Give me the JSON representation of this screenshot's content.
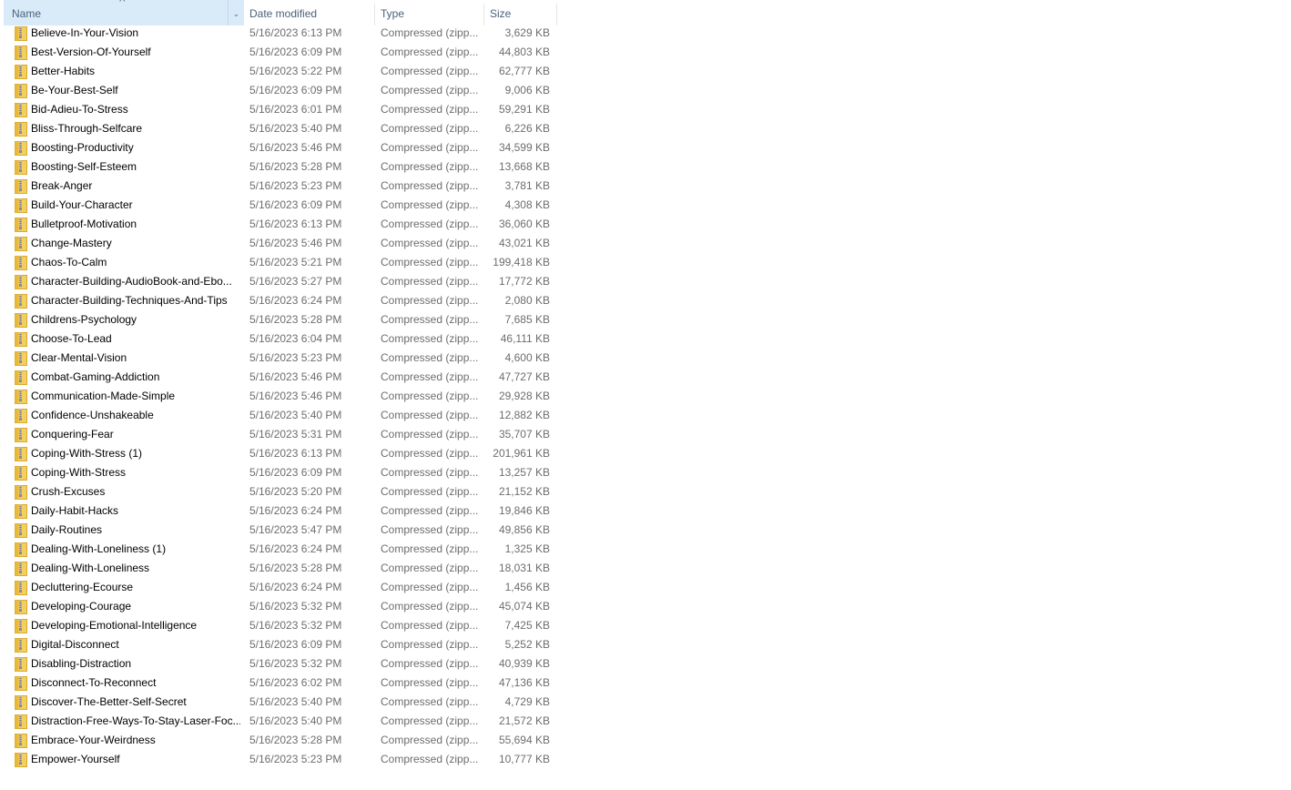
{
  "columns": {
    "name": "Name",
    "date": "Date modified",
    "type": "Type",
    "size": "Size"
  },
  "sort": {
    "column": "name",
    "direction": "ascending"
  },
  "colors": {
    "header_active_bg": "#d9ebf9",
    "header_text": "#4c607a",
    "secondary_text": "#6d6d6d",
    "zip_icon": "#f2c94c"
  },
  "files": [
    {
      "name": "Believe-In-Your-Vision",
      "date": "5/16/2023 6:13 PM",
      "type": "Compressed (zipp...",
      "size": "3,629 KB"
    },
    {
      "name": "Best-Version-Of-Yourself",
      "date": "5/16/2023 6:09 PM",
      "type": "Compressed (zipp...",
      "size": "44,803 KB"
    },
    {
      "name": "Better-Habits",
      "date": "5/16/2023 5:22 PM",
      "type": "Compressed (zipp...",
      "size": "62,777 KB"
    },
    {
      "name": "Be-Your-Best-Self",
      "date": "5/16/2023 6:09 PM",
      "type": "Compressed (zipp...",
      "size": "9,006 KB"
    },
    {
      "name": "Bid-Adieu-To-Stress",
      "date": "5/16/2023 6:01 PM",
      "type": "Compressed (zipp...",
      "size": "59,291 KB"
    },
    {
      "name": "Bliss-Through-Selfcare",
      "date": "5/16/2023 5:40 PM",
      "type": "Compressed (zipp...",
      "size": "6,226 KB"
    },
    {
      "name": "Boosting-Productivity",
      "date": "5/16/2023 5:46 PM",
      "type": "Compressed (zipp...",
      "size": "34,599 KB"
    },
    {
      "name": "Boosting-Self-Esteem",
      "date": "5/16/2023 5:28 PM",
      "type": "Compressed (zipp...",
      "size": "13,668 KB"
    },
    {
      "name": "Break-Anger",
      "date": "5/16/2023 5:23 PM",
      "type": "Compressed (zipp...",
      "size": "3,781 KB"
    },
    {
      "name": "Build-Your-Character",
      "date": "5/16/2023 6:09 PM",
      "type": "Compressed (zipp...",
      "size": "4,308 KB"
    },
    {
      "name": "Bulletproof-Motivation",
      "date": "5/16/2023 6:13 PM",
      "type": "Compressed (zipp...",
      "size": "36,060 KB"
    },
    {
      "name": "Change-Mastery",
      "date": "5/16/2023 5:46 PM",
      "type": "Compressed (zipp...",
      "size": "43,021 KB"
    },
    {
      "name": "Chaos-To-Calm",
      "date": "5/16/2023 5:21 PM",
      "type": "Compressed (zipp...",
      "size": "199,418 KB"
    },
    {
      "name": "Character-Building-AudioBook-and-Ebo...",
      "date": "5/16/2023 5:27 PM",
      "type": "Compressed (zipp...",
      "size": "17,772 KB"
    },
    {
      "name": "Character-Building-Techniques-And-Tips",
      "date": "5/16/2023 6:24 PM",
      "type": "Compressed (zipp...",
      "size": "2,080 KB"
    },
    {
      "name": "Childrens-Psychology",
      "date": "5/16/2023 5:28 PM",
      "type": "Compressed (zipp...",
      "size": "7,685 KB"
    },
    {
      "name": "Choose-To-Lead",
      "date": "5/16/2023 6:04 PM",
      "type": "Compressed (zipp...",
      "size": "46,111 KB"
    },
    {
      "name": "Clear-Mental-Vision",
      "date": "5/16/2023 5:23 PM",
      "type": "Compressed (zipp...",
      "size": "4,600 KB"
    },
    {
      "name": "Combat-Gaming-Addiction",
      "date": "5/16/2023 5:46 PM",
      "type": "Compressed (zipp...",
      "size": "47,727 KB"
    },
    {
      "name": "Communication-Made-Simple",
      "date": "5/16/2023 5:46 PM",
      "type": "Compressed (zipp...",
      "size": "29,928 KB"
    },
    {
      "name": "Confidence-Unshakeable",
      "date": "5/16/2023 5:40 PM",
      "type": "Compressed (zipp...",
      "size": "12,882 KB"
    },
    {
      "name": "Conquering-Fear",
      "date": "5/16/2023 5:31 PM",
      "type": "Compressed (zipp...",
      "size": "35,707 KB"
    },
    {
      "name": "Coping-With-Stress (1)",
      "date": "5/16/2023 6:13 PM",
      "type": "Compressed (zipp...",
      "size": "201,961 KB"
    },
    {
      "name": "Coping-With-Stress",
      "date": "5/16/2023 6:09 PM",
      "type": "Compressed (zipp...",
      "size": "13,257 KB"
    },
    {
      "name": "Crush-Excuses",
      "date": "5/16/2023 5:20 PM",
      "type": "Compressed (zipp...",
      "size": "21,152 KB"
    },
    {
      "name": "Daily-Habit-Hacks",
      "date": "5/16/2023 6:24 PM",
      "type": "Compressed (zipp...",
      "size": "19,846 KB"
    },
    {
      "name": "Daily-Routines",
      "date": "5/16/2023 5:47 PM",
      "type": "Compressed (zipp...",
      "size": "49,856 KB"
    },
    {
      "name": "Dealing-With-Loneliness (1)",
      "date": "5/16/2023 6:24 PM",
      "type": "Compressed (zipp...",
      "size": "1,325 KB"
    },
    {
      "name": "Dealing-With-Loneliness",
      "date": "5/16/2023 5:28 PM",
      "type": "Compressed (zipp...",
      "size": "18,031 KB"
    },
    {
      "name": "Decluttering-Ecourse",
      "date": "5/16/2023 6:24 PM",
      "type": "Compressed (zipp...",
      "size": "1,456 KB"
    },
    {
      "name": "Developing-Courage",
      "date": "5/16/2023 5:32 PM",
      "type": "Compressed (zipp...",
      "size": "45,074 KB"
    },
    {
      "name": "Developing-Emotional-Intelligence",
      "date": "5/16/2023 5:32 PM",
      "type": "Compressed (zipp...",
      "size": "7,425 KB"
    },
    {
      "name": "Digital-Disconnect",
      "date": "5/16/2023 6:09 PM",
      "type": "Compressed (zipp...",
      "size": "5,252 KB"
    },
    {
      "name": "Disabling-Distraction",
      "date": "5/16/2023 5:32 PM",
      "type": "Compressed (zipp...",
      "size": "40,939 KB"
    },
    {
      "name": "Disconnect-To-Reconnect",
      "date": "5/16/2023 6:02 PM",
      "type": "Compressed (zipp...",
      "size": "47,136 KB"
    },
    {
      "name": "Discover-The-Better-Self-Secret",
      "date": "5/16/2023 5:40 PM",
      "type": "Compressed (zipp...",
      "size": "4,729 KB"
    },
    {
      "name": "Distraction-Free-Ways-To-Stay-Laser-Foc...",
      "date": "5/16/2023 5:40 PM",
      "type": "Compressed (zipp...",
      "size": "21,572 KB"
    },
    {
      "name": "Embrace-Your-Weirdness",
      "date": "5/16/2023 5:28 PM",
      "type": "Compressed (zipp...",
      "size": "55,694 KB"
    },
    {
      "name": "Empower-Yourself",
      "date": "5/16/2023 5:23 PM",
      "type": "Compressed (zipp...",
      "size": "10,777 KB"
    }
  ]
}
